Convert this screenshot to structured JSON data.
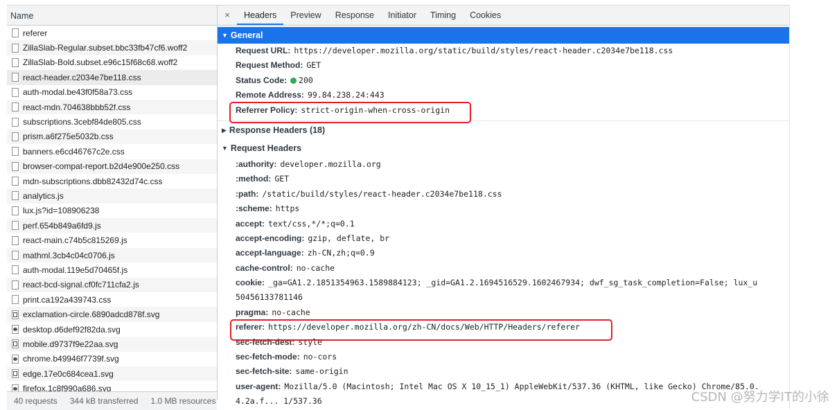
{
  "left_panel": {
    "header": "Name",
    "requests": [
      {
        "name": "referer",
        "icon": "document-icon"
      },
      {
        "name": "ZillaSlab-Regular.subset.bbc33fb47cf6.woff2",
        "icon": "document-icon"
      },
      {
        "name": "ZillaSlab-Bold.subset.e96c15f68c68.woff2",
        "icon": "document-icon"
      },
      {
        "name": "react-header.c2034e7be118.css",
        "icon": "document-icon"
      },
      {
        "name": "auth-modal.be43f0f58a73.css",
        "icon": "document-icon"
      },
      {
        "name": "react-mdn.704638bbb52f.css",
        "icon": "document-icon"
      },
      {
        "name": "subscriptions.3cebf84de805.css",
        "icon": "document-icon"
      },
      {
        "name": "prism.a6f275e5032b.css",
        "icon": "document-icon"
      },
      {
        "name": "banners.e6cd46767c2e.css",
        "icon": "document-icon"
      },
      {
        "name": "browser-compat-report.b2d4e900e250.css",
        "icon": "document-icon"
      },
      {
        "name": "mdn-subscriptions.dbb82432d74c.css",
        "icon": "document-icon"
      },
      {
        "name": "analytics.js",
        "icon": "document-icon"
      },
      {
        "name": "lux.js?id=108906238",
        "icon": "document-icon"
      },
      {
        "name": "perf.654b849a6fd9.js",
        "icon": "document-icon"
      },
      {
        "name": "react-main.c74b5c815269.js",
        "icon": "document-icon"
      },
      {
        "name": "mathml.3cb4c04c0706.js",
        "icon": "document-icon"
      },
      {
        "name": "auth-modal.119e5d70465f.js",
        "icon": "document-icon"
      },
      {
        "name": "react-bcd-signal.cf0fc711cfa2.js",
        "icon": "document-icon"
      },
      {
        "name": "print.ca192a439743.css",
        "icon": "document-icon"
      },
      {
        "name": "exclamation-circle.6890adcd878f.svg",
        "icon": "image-icon"
      },
      {
        "name": "desktop.d6def92f82da.svg",
        "icon": "image-icon"
      },
      {
        "name": "mobile.d9737f9e22aa.svg",
        "icon": "image-icon"
      },
      {
        "name": "chrome.b49946f7739f.svg",
        "icon": "image-icon"
      },
      {
        "name": "edge.17e0c684cea1.svg",
        "icon": "image-icon"
      },
      {
        "name": "firefox.1c8f990a686.svg",
        "icon": "image-icon"
      }
    ],
    "selected_index": 3
  },
  "status_bar": {
    "requests": "40 requests",
    "transferred": "344 kB transferred",
    "resources": "1.0 MB resources"
  },
  "tabs": {
    "close": "×",
    "items": [
      "Headers",
      "Preview",
      "Response",
      "Initiator",
      "Timing",
      "Cookies"
    ],
    "active": "Headers"
  },
  "general": {
    "title": "General",
    "rows": [
      {
        "key": "Request URL:",
        "value": "https://developer.mozilla.org/static/build/styles/react-header.c2034e7be118.css"
      },
      {
        "key": "Request Method:",
        "value": "GET"
      },
      {
        "key": "Status Code:",
        "value": "200"
      },
      {
        "key": "Remote Address:",
        "value": "99.84.238.24:443"
      },
      {
        "key": "Referrer Policy:",
        "value": "strict-origin-when-cross-origin"
      }
    ]
  },
  "response_headers": {
    "title": "Response Headers (18)"
  },
  "request_headers": {
    "title": "Request Headers",
    "rows": [
      {
        "key": ":authority:",
        "value": "developer.mozilla.org"
      },
      {
        "key": ":method:",
        "value": "GET"
      },
      {
        "key": ":path:",
        "value": "/static/build/styles/react-header.c2034e7be118.css"
      },
      {
        "key": ":scheme:",
        "value": "https"
      },
      {
        "key": "accept:",
        "value": "text/css,*/*;q=0.1"
      },
      {
        "key": "accept-encoding:",
        "value": "gzip, deflate, br"
      },
      {
        "key": "accept-language:",
        "value": "zh-CN,zh;q=0.9"
      },
      {
        "key": "cache-control:",
        "value": "no-cache"
      },
      {
        "key": "cookie:",
        "value": "_ga=GA1.2.1851354963.1589884123; _gid=GA1.2.1694516529.1602467934; dwf_sg_task_completion=False; lux_u"
      },
      {
        "key": "",
        "value": "50456133781146"
      },
      {
        "key": "pragma:",
        "value": "no-cache"
      },
      {
        "key": "referer:",
        "value": "https://developer.mozilla.org/zh-CN/docs/Web/HTTP/Headers/referer"
      },
      {
        "key": "sec-fetch-dest:",
        "value": "style"
      },
      {
        "key": "sec-fetch-mode:",
        "value": "no-cors"
      },
      {
        "key": "sec-fetch-site:",
        "value": "same-origin"
      },
      {
        "key": "user-agent:",
        "value": "Mozilla/5.0 (Macintosh; Intel Mac OS X 10_15_1) AppleWebKit/537.36 (KHTML, like Gecko) Chrome/85.0."
      },
      {
        "key": "",
        "value": "4.2a.f... 1/537.36"
      }
    ]
  },
  "watermark": "CSDN @努力学IT的小徐",
  "colors": {
    "accent": "#1a73e8",
    "highlight": "#e31d24",
    "status_ok": "#35a852"
  }
}
